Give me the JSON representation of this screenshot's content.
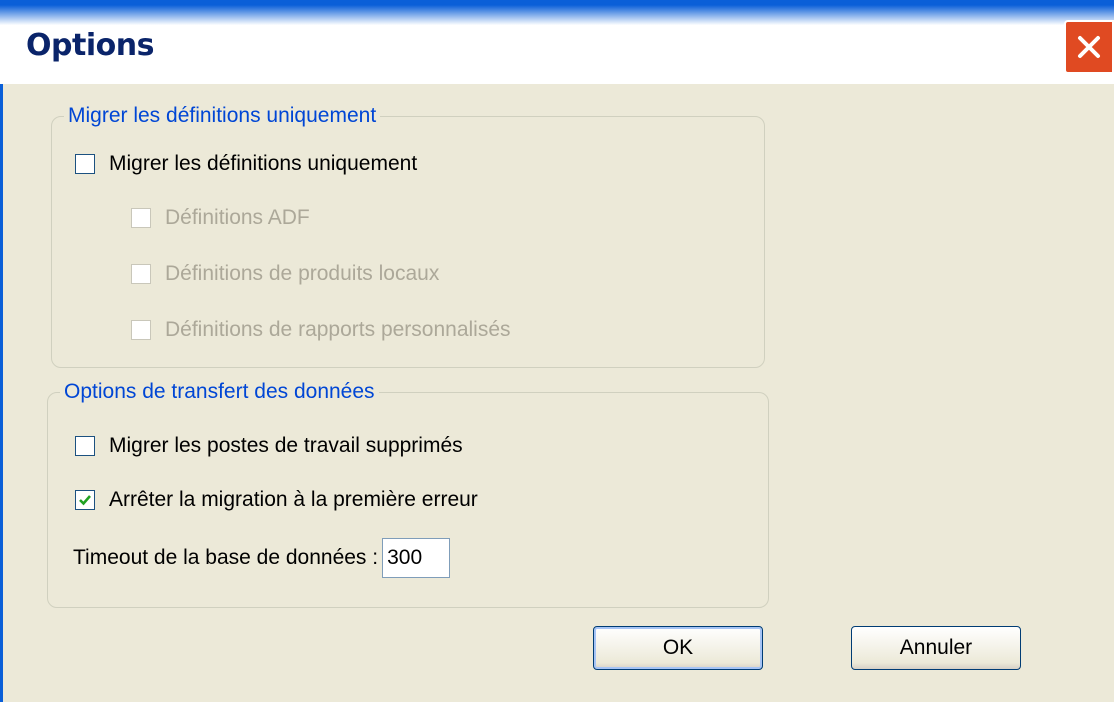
{
  "window": {
    "title": "Options",
    "close_icon": "close-icon"
  },
  "group_definitions": {
    "legend": "Migrer les définitions uniquement",
    "master": {
      "label": "Migrer les définitions uniquement",
      "checked": false,
      "enabled": true
    },
    "items": [
      {
        "label": "Définitions ADF",
        "checked": false,
        "enabled": false
      },
      {
        "label": "Définitions de produits locaux",
        "checked": false,
        "enabled": false
      },
      {
        "label": "Définitions de rapports personnalisés",
        "checked": false,
        "enabled": false
      }
    ]
  },
  "group_transfer": {
    "legend": "Options de transfert des données",
    "deleted_workstations": {
      "label": "Migrer les postes de travail supprimés",
      "checked": false
    },
    "stop_on_error": {
      "label": "Arrêter la migration à la première erreur",
      "checked": true
    },
    "timeout": {
      "label": "Timeout de la base de données :",
      "value": "300"
    }
  },
  "buttons": {
    "ok": "OK",
    "cancel": "Annuler"
  },
  "colors": {
    "accent": "#0046d5",
    "check": "#21a121",
    "close": "#e04a22"
  }
}
